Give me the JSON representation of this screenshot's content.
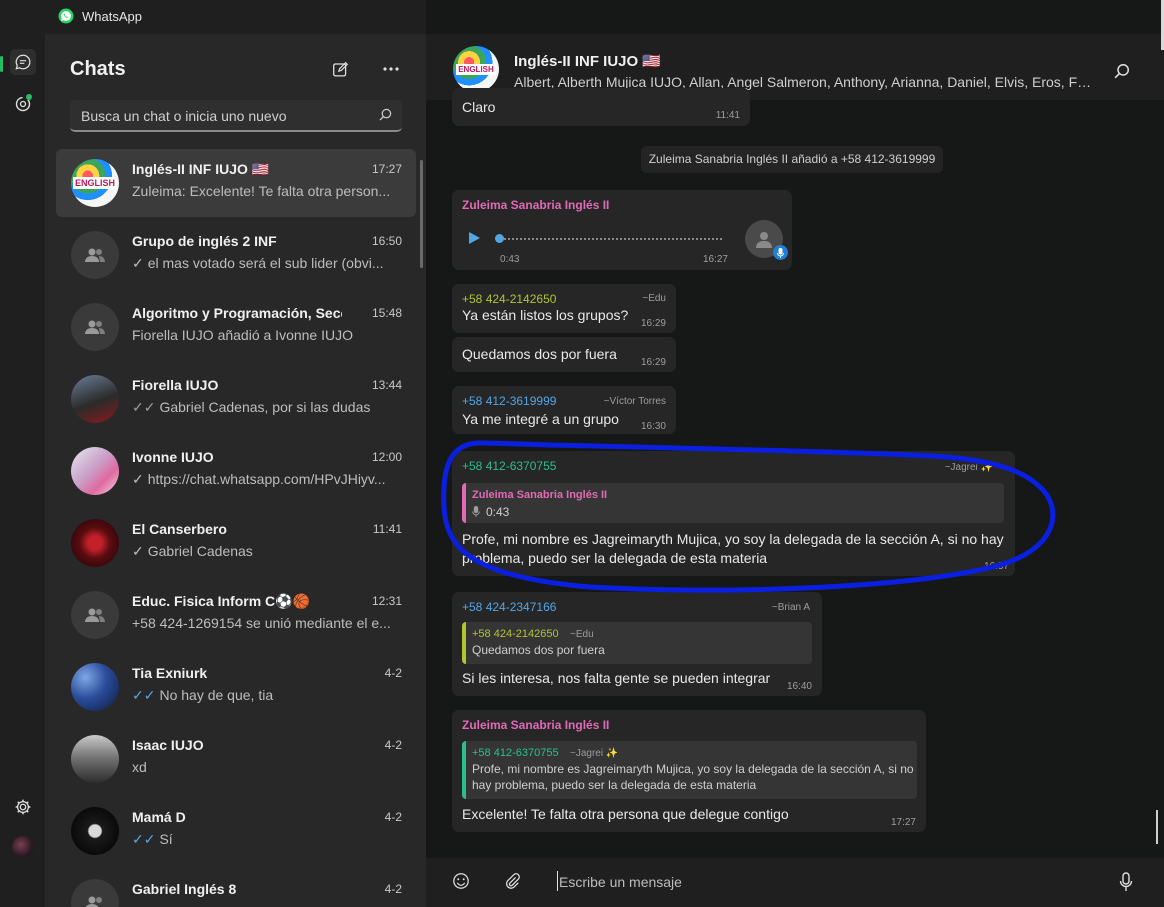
{
  "app": {
    "title": "WhatsApp"
  },
  "sidebar": {
    "title": "Chats",
    "search_placeholder": "Busca un chat o inicia uno nuevo",
    "chats": [
      {
        "name": "Inglés-II INF IUJO 🇺🇸",
        "time": "17:27",
        "preview": "Zuleima: Excelente! Te falta otra person...",
        "tick": ""
      },
      {
        "name": "Grupo de inglés 2 INF",
        "time": "16:50",
        "preview": "el mas votado será el sub lider (obvi...",
        "tick": "✓"
      },
      {
        "name": "Algoritmo y Programación, Sección",
        "time": "15:48",
        "preview": "Fiorella IUJO añadió a Ivonne IUJO",
        "tick": ""
      },
      {
        "name": "Fiorella IUJO",
        "time": "13:44",
        "preview": "Gabriel Cadenas, por si las dudas",
        "tick": "✓✓"
      },
      {
        "name": "Ivonne IUJO",
        "time": "12:00",
        "preview": "https://chat.whatsapp.com/HPvJHiyv...",
        "tick": "✓"
      },
      {
        "name": "El Canserbero",
        "time": "11:41",
        "preview": "Gabriel Cadenas",
        "tick": "✓"
      },
      {
        "name": "Educ. Fisica Inform C⚽🏀",
        "time": "12:31",
        "preview": "+58 424-1269154 se unió mediante el e...",
        "tick": ""
      },
      {
        "name": "Tia Exniurk",
        "time": "4-2",
        "preview": "No hay de que, tia",
        "tick": "✓✓"
      },
      {
        "name": "Isaac IUJO",
        "time": "4-2",
        "preview": "xd",
        "tick": ""
      },
      {
        "name": "Mamá D",
        "time": "4-2",
        "preview": "Sí",
        "tick": "✓✓"
      },
      {
        "name": "Gabriel Inglés 8",
        "time": "4-2",
        "preview": "",
        "tick": ""
      }
    ]
  },
  "header": {
    "name": "Inglés-II INF IUJO 🇺🇸",
    "members": "Albert, Alberth Mujica IUJO, Allan, Angel Salmeron, Anthony, Arianna, Daniel, Elvis, Eros, Fiorella IUJO"
  },
  "messages": {
    "m0": {
      "text": "Claro",
      "time": "11:41"
    },
    "system": "Zuleima Sanabria Inglés II añadió a +58 412-3619999",
    "m1": {
      "sender": "Zuleima Sanabria Inglés II",
      "duration": "0:43",
      "time": "16:27"
    },
    "m2": {
      "sender": "+58 424-2142650",
      "alias": "~Edu",
      "text": "Ya están listos los grupos?",
      "time": "16:29"
    },
    "m3": {
      "text": "Quedamos dos por fuera",
      "time": "16:29"
    },
    "m4": {
      "sender": "+58 412-3619999",
      "alias": "~Víctor Torres",
      "text": "Ya me integré a un grupo",
      "time": "16:30"
    },
    "m5": {
      "sender": "+58 412-6370755",
      "alias": "~Jagrei ✨",
      "quote_sender": "Zuleima Sanabria Inglés II",
      "quote_text": "0:43",
      "text_1": "Profe, mi nombre es Jagreimaryth Mujica, yo soy la delegada de la sección A, si no hay",
      "text_2": "problema, puedo ser la delegada de esta materia",
      "time": "16:37"
    },
    "m6": {
      "sender": "+58 424-2347166",
      "alias": "~Brian A",
      "quote_sender": "+58 424-2142650",
      "quote_alias": "~Edu",
      "quote_text": "Quedamos dos por fuera",
      "text": "Si les interesa, nos falta gente se pueden integrar",
      "time": "16:40"
    },
    "m7": {
      "sender": "Zuleima Sanabria Inglés II",
      "quote_sender": "+58 412-6370755",
      "quote_alias": "~Jagrei ✨",
      "quote_text_1": "Profe, mi nombre es Jagreimaryth Mujica, yo soy la delegada de la sección A, si no",
      "quote_text_2": "hay problema, puedo ser la delegada de esta materia",
      "text": "Excelente! Te falta otra persona que delegue contigo",
      "time": "17:27"
    }
  },
  "composer": {
    "placeholder": "Escribe un mensaje"
  },
  "colors": {
    "accent": "#21c063",
    "pink_sender": "#e26ab6",
    "green_sender": "#2bbf8f",
    "blue_sender": "#53a6e6",
    "yellow_sender": "#b3c52f",
    "highlight": "#0a1fe0"
  }
}
